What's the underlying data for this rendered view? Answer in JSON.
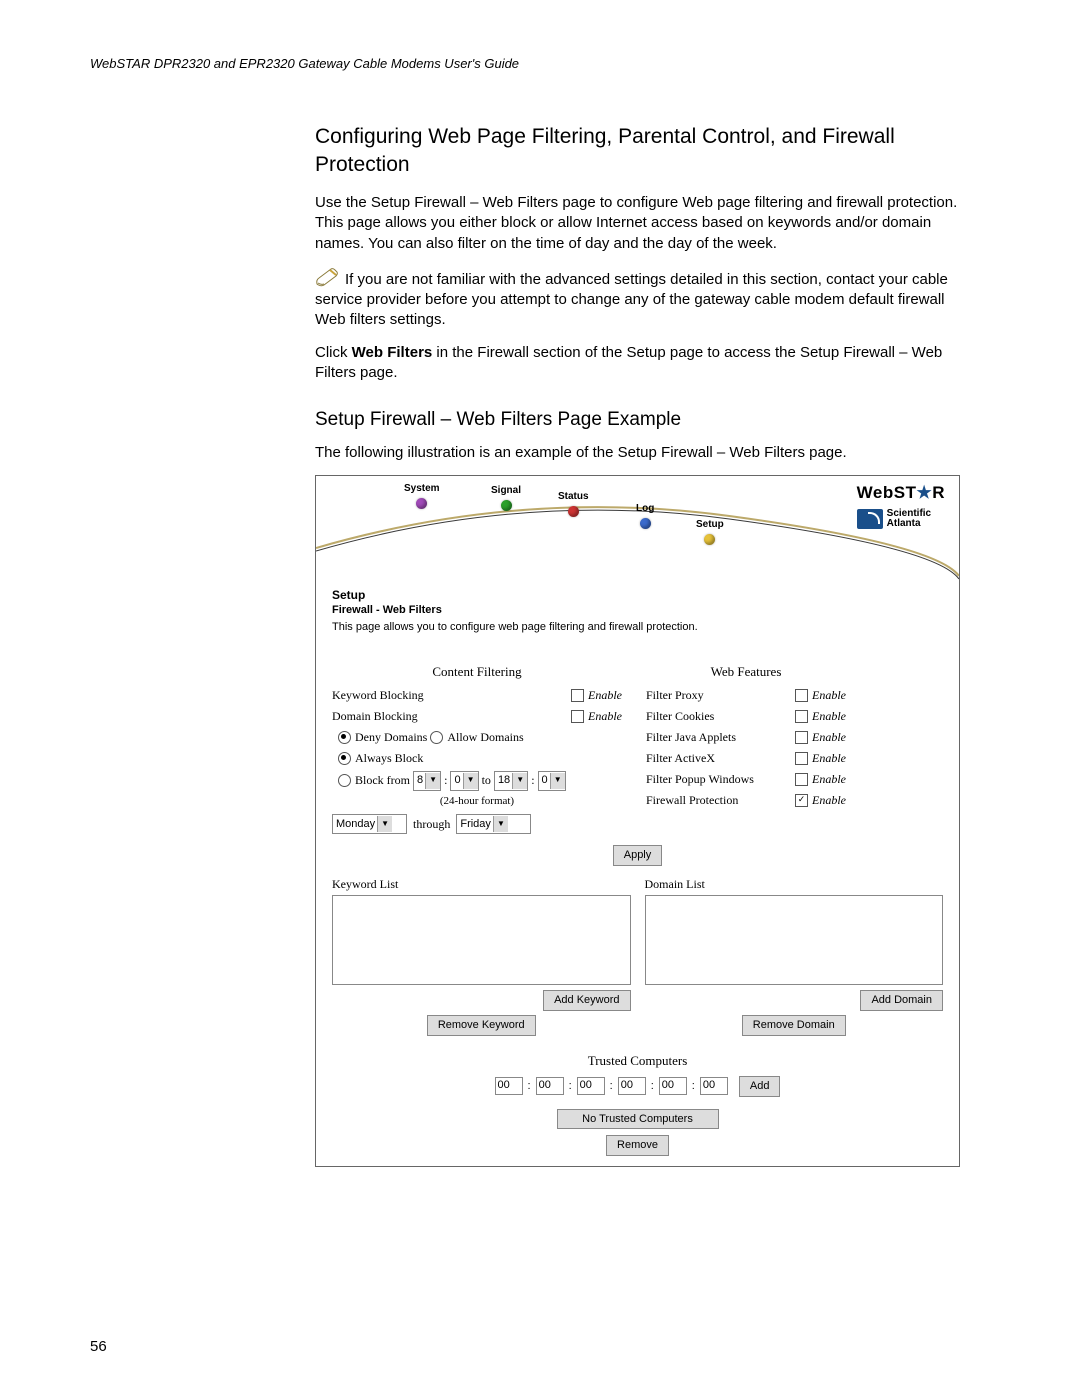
{
  "runhead": "WebSTAR DPR2320 and EPR2320 Gateway Cable Modems User's Guide",
  "title": "Configuring Web Page Filtering, Parental Control, and Firewall Protection",
  "para1": "Use the Setup Firewall – Web Filters page to configure Web page filtering and firewall protection. This page allows you either block or allow Internet access based on keywords and/or domain names. You can also filter on the time of day and the day of the week.",
  "note": "If you are not familiar with the advanced settings detailed in this section, contact your cable service provider before you attempt to change any of the gateway cable modem default firewall Web filters settings.",
  "para2a": "Click ",
  "para2b": "Web Filters",
  "para2c": " in the Firewall section of the Setup page to access the Setup Firewall – Web Filters page.",
  "subtitle": "Setup Firewall – Web Filters Page Example",
  "para3": "The following illustration is an example of the Setup Firewall – Web Filters page.",
  "page_num": "56",
  "nav": {
    "system": "System",
    "signal": "Signal",
    "status": "Status",
    "log": "Log",
    "setup": "Setup"
  },
  "logo": {
    "brand_a": "WebST",
    "brand_b": "R",
    "company1": "Scientific",
    "company2": "Atlanta"
  },
  "setup": {
    "h": "Setup",
    "sub": "Firewall - Web Filters",
    "desc": "This page allows you to configure web page filtering and firewall protection."
  },
  "cf": {
    "header": "Content Filtering",
    "kb": "Keyword Blocking",
    "db": "Domain Blocking",
    "deny": "Deny Domains",
    "allow": "Allow Domains",
    "always": "Always Block",
    "block_from": "Block from",
    "to": "to",
    "h1": "8",
    "m1": "0",
    "h2": "18",
    "m2": "0",
    "fmt": "(24-hour format)",
    "day1": "Monday",
    "through": "through",
    "day2": "Friday",
    "enable": "Enable"
  },
  "wf": {
    "header": "Web Features",
    "r1": "Filter Proxy",
    "r2": "Filter Cookies",
    "r3": "Filter Java Applets",
    "r4": "Filter ActiveX",
    "r5": "Filter Popup Windows",
    "r6": "Firewall Protection",
    "enable": "Enable"
  },
  "apply": "Apply",
  "lists": {
    "kl": "Keyword List",
    "dl": "Domain List",
    "add_k": "Add Keyword",
    "rem_k": "Remove Keyword",
    "add_d": "Add Domain",
    "rem_d": "Remove Domain"
  },
  "trusted": {
    "h": "Trusted Computers",
    "mac": [
      "00",
      "00",
      "00",
      "00",
      "00",
      "00"
    ],
    "add": "Add",
    "none": "No Trusted Computers",
    "remove": "Remove"
  }
}
